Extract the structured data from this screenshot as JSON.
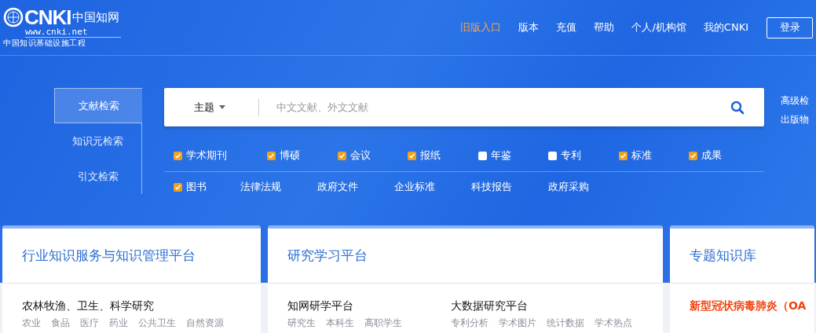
{
  "header": {
    "logo": {
      "brand": "CNKI",
      "name_cn": "中国知网",
      "url": "www.cnki.net",
      "slogan": "中国知识基础设施工程"
    },
    "nav": [
      {
        "label": "旧版入口",
        "highlighted": true
      },
      {
        "label": "版本",
        "highlighted": false
      },
      {
        "label": "充值",
        "highlighted": false
      },
      {
        "label": "帮助",
        "highlighted": false
      },
      {
        "label": "个人/机构馆",
        "highlighted": false
      },
      {
        "label": "我的CNKI",
        "highlighted": false
      }
    ],
    "login_button": "登录"
  },
  "search": {
    "tabs": [
      {
        "label": "文献检索",
        "selected": true
      },
      {
        "label": "知识元检索",
        "selected": false
      },
      {
        "label": "引文检索",
        "selected": false
      }
    ],
    "field_select": "主题",
    "placeholder": "中文文献、外文文献",
    "sources_row_1": [
      {
        "kind": "checkbox",
        "label": "学术期刊",
        "checked": true
      },
      {
        "kind": "checkbox",
        "label": "博硕",
        "checked": true
      },
      {
        "kind": "checkbox",
        "label": "会议",
        "checked": true
      },
      {
        "kind": "checkbox",
        "label": "报纸",
        "checked": true
      },
      {
        "kind": "checkbox",
        "label": "年鉴",
        "checked": false
      },
      {
        "kind": "checkbox",
        "label": "专利",
        "checked": false
      },
      {
        "kind": "checkbox",
        "label": "标准",
        "checked": true
      },
      {
        "kind": "checkbox",
        "label": "成果",
        "checked": true
      }
    ],
    "sources_row_2": [
      {
        "kind": "checkbox",
        "label": "图书",
        "checked": true
      },
      {
        "kind": "link",
        "label": "法律法规"
      },
      {
        "kind": "link",
        "label": "政府文件"
      },
      {
        "kind": "link",
        "label": "企业标准"
      },
      {
        "kind": "link",
        "label": "科技报告"
      },
      {
        "kind": "link",
        "label": "政府采购"
      }
    ],
    "side_links": [
      "高级检",
      "出版物"
    ]
  },
  "cards": [
    {
      "title": "行业知识服务与知识管理平台",
      "groups": [
        {
          "title": "农林牧渔、卫生、科学研究",
          "links": [
            "农业",
            "食品",
            "医疗",
            "药业",
            "公共卫生",
            "自然资源"
          ]
        }
      ]
    },
    {
      "title": "研究学习平台",
      "groups": [
        {
          "title": "知网研学平台",
          "links": [
            "研究生",
            "本科生",
            "高职学生"
          ]
        },
        {
          "title": "大数据研究平台",
          "links": [
            "专利分析",
            "学术图片",
            "统计数据",
            "学术热点"
          ]
        }
      ]
    },
    {
      "title": "专题知识库",
      "groups": [
        {
          "title": "新型冠状病毒肺炎（OA"
        }
      ]
    }
  ]
}
